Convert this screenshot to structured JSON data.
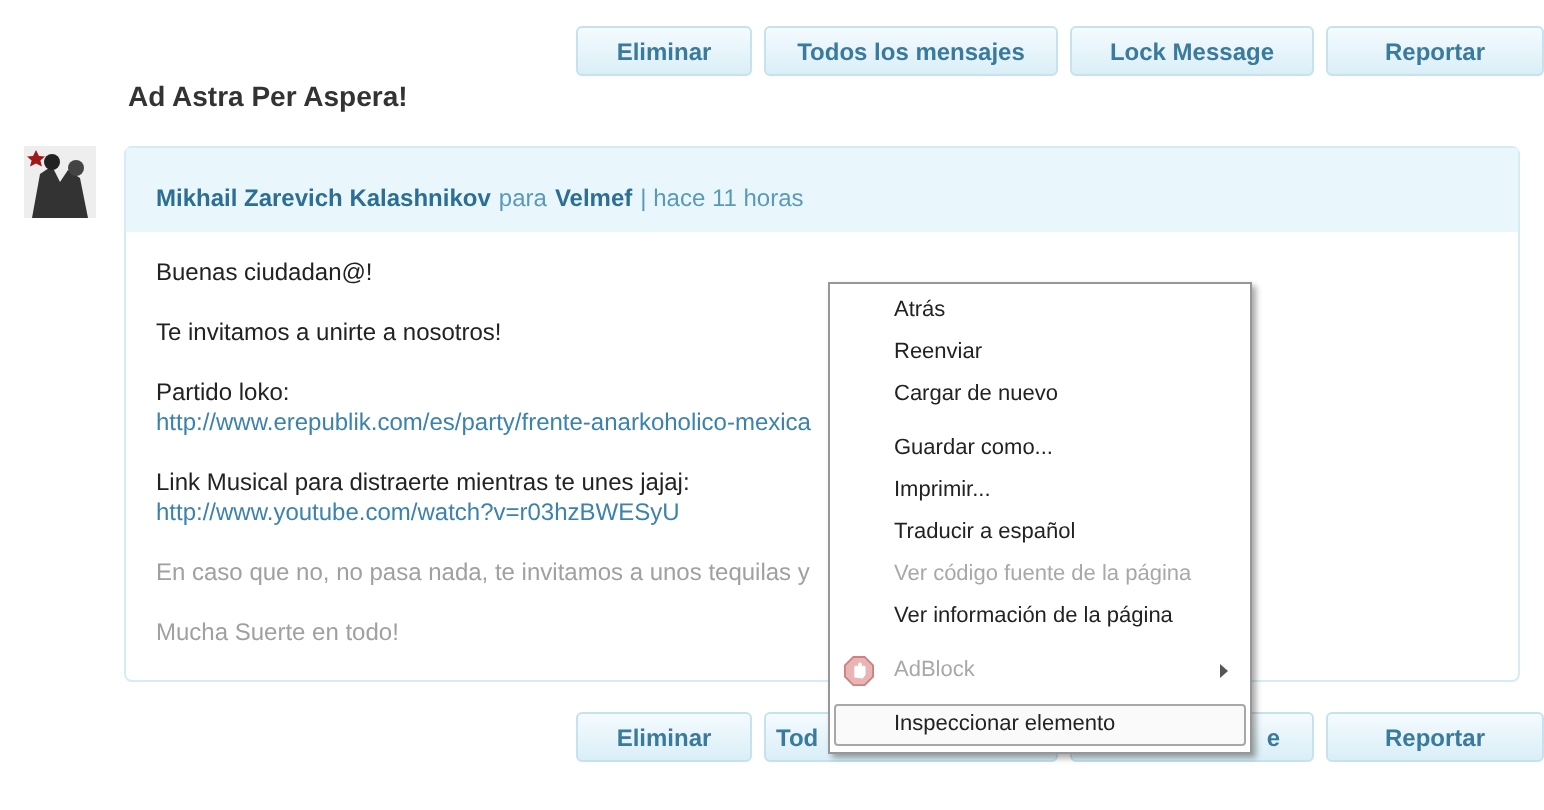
{
  "top_actions": [
    {
      "label": "Eliminar"
    },
    {
      "label": "Todos los mensajes"
    },
    {
      "label": "Lock Message"
    },
    {
      "label": "Reportar"
    }
  ],
  "thread_title": "Ad Astra Per Aspera!",
  "message": {
    "sender": "Mikhail Zarevich Kalashnikov",
    "connector": "para",
    "recipient": "Velmef",
    "time": "| hace 11 horas",
    "paragraphs": [
      [
        {
          "kind": "text",
          "text": "Buenas ciudadan@!"
        }
      ],
      [
        {
          "kind": "text",
          "text": "Te invitamos a unirte a nosotros!"
        }
      ],
      [
        {
          "kind": "text",
          "text": "Partido loko:"
        },
        {
          "kind": "link",
          "text": "http://www.erepublik.com/es/party/frente-anarkoholico-mexica"
        }
      ],
      [
        {
          "kind": "text",
          "text": "Link Musical para distraerte mientras te unes jajaj:"
        },
        {
          "kind": "link",
          "text": "http://www.youtube.com/watch?v=r03hzBWESyU"
        }
      ],
      [
        {
          "kind": "muted",
          "text": "En caso que no, no pasa nada, te invitamos a unos tequilas y"
        }
      ],
      [
        {
          "kind": "muted",
          "text": "Mucha Suerte en todo!"
        }
      ]
    ]
  },
  "bottom_actions": [
    {
      "label": "Eliminar",
      "kind": "full"
    },
    {
      "label": "Tod",
      "kind": "head"
    },
    {
      "label": "e",
      "kind": "tail"
    },
    {
      "label": "Reportar",
      "kind": "full"
    }
  ],
  "context_menu": {
    "groups": [
      [
        {
          "label": "Atrás",
          "disabled": false,
          "selected": false
        },
        {
          "label": "Reenviar",
          "disabled": false,
          "selected": false
        },
        {
          "label": "Cargar de nuevo",
          "disabled": false,
          "selected": false
        }
      ],
      [
        {
          "label": "Guardar como...",
          "disabled": false,
          "selected": false
        },
        {
          "label": "Imprimir...",
          "disabled": false,
          "selected": false
        },
        {
          "label": "Traducir a español",
          "disabled": false,
          "selected": false
        },
        {
          "label": "Ver código fuente de la página",
          "disabled": true,
          "selected": false
        },
        {
          "label": "Ver información de la página",
          "disabled": false,
          "selected": false
        }
      ],
      [
        {
          "label": "AdBlock",
          "disabled": true,
          "selected": false,
          "kind": "extension"
        }
      ],
      [
        {
          "label": "Inspeccionar elemento",
          "disabled": false,
          "selected": true
        }
      ]
    ]
  }
}
